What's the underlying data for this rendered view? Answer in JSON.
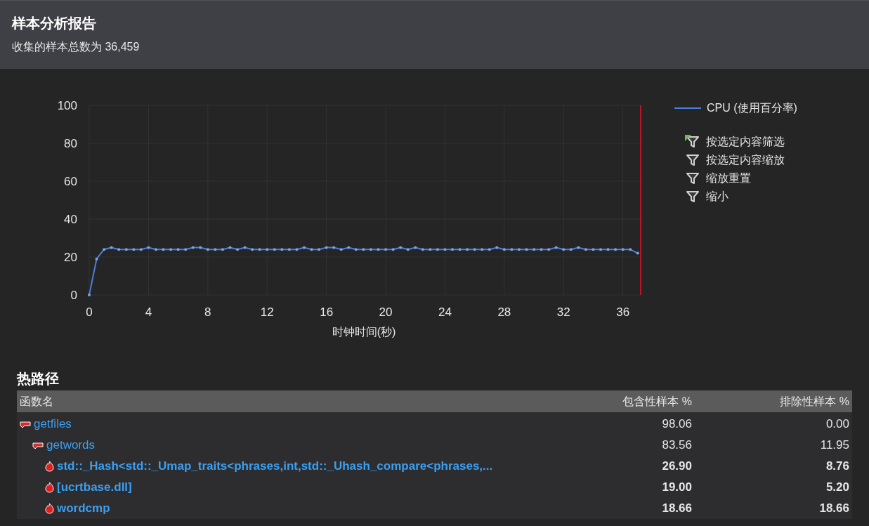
{
  "header": {
    "title": "样本分析报告",
    "subtitle": "收集的样本总数为 36,459"
  },
  "chart_data": {
    "type": "line",
    "xlabel": "时钟时间(秒)",
    "xlim": [
      0,
      37.2
    ],
    "ylim": [
      0,
      100
    ],
    "xticks": [
      0,
      4,
      8,
      12,
      16,
      20,
      24,
      28,
      32,
      36
    ],
    "yticks": [
      0,
      20,
      40,
      60,
      80,
      100
    ],
    "x": [
      0,
      0.5,
      1,
      1.5,
      2,
      2.5,
      3,
      3.5,
      4,
      4.5,
      5,
      5.5,
      6,
      6.5,
      7,
      7.5,
      8,
      8.5,
      9,
      9.5,
      10,
      10.5,
      11,
      11.5,
      12,
      12.5,
      13,
      13.5,
      14,
      14.5,
      15,
      15.5,
      16,
      16.5,
      17,
      17.5,
      18,
      18.5,
      19,
      19.5,
      20,
      20.5,
      21,
      21.5,
      22,
      22.5,
      23,
      23.5,
      24,
      24.5,
      25,
      25.5,
      26,
      26.5,
      27,
      27.5,
      28,
      28.5,
      29,
      29.5,
      30,
      30.5,
      31,
      31.5,
      32,
      32.5,
      33,
      33.5,
      34,
      34.5,
      35,
      35.5,
      36,
      36.5,
      37
    ],
    "series": [
      {
        "name": "CPU (使用百分率)",
        "color": "#4a7fd8",
        "values": [
          0,
          19,
          24,
          25,
          24,
          24,
          24,
          24,
          25,
          24,
          24,
          24,
          24,
          24,
          25,
          25,
          24,
          24,
          24,
          25,
          24,
          25,
          24,
          24,
          24,
          24,
          24,
          24,
          24,
          25,
          24,
          24,
          25,
          25,
          24,
          25,
          24,
          24,
          24,
          24,
          24,
          24,
          25,
          24,
          25,
          24,
          24,
          24,
          24,
          24,
          24,
          24,
          24,
          24,
          24,
          25,
          24,
          24,
          24,
          24,
          24,
          24,
          24,
          25,
          24,
          24,
          25,
          24,
          24,
          24,
          24,
          24,
          24,
          24,
          22
        ]
      }
    ],
    "grid": true
  },
  "chart_actions": [
    {
      "label": "按选定内容筛选",
      "highlighted": true
    },
    {
      "label": "按选定内容缩放",
      "highlighted": false
    },
    {
      "label": "缩放重置",
      "highlighted": false
    },
    {
      "label": "缩小",
      "highlighted": false
    }
  ],
  "hot_path": {
    "title": "热路径",
    "columns": [
      "函数名",
      "包含性样本 %",
      "排除性样本 %"
    ],
    "rows": [
      {
        "kind": "path",
        "name": "getfiles",
        "inclusive": "98.06",
        "exclusive": "0.00",
        "children": [
          {
            "kind": "path",
            "name": "getwords",
            "inclusive": "83.56",
            "exclusive": "11.95",
            "children": [
              {
                "kind": "hot",
                "name": "std::_Hash<std::_Umap_traits<phrases,int,std::_Uhash_compare<phrases,...",
                "inclusive": "26.90",
                "exclusive": "8.76"
              },
              {
                "kind": "hot",
                "name": "[ucrtbase.dll]",
                "inclusive": "19.00",
                "exclusive": "5.20"
              },
              {
                "kind": "hot",
                "name": "wordcmp",
                "inclusive": "18.66",
                "exclusive": "18.66"
              }
            ]
          }
        ]
      }
    ]
  }
}
